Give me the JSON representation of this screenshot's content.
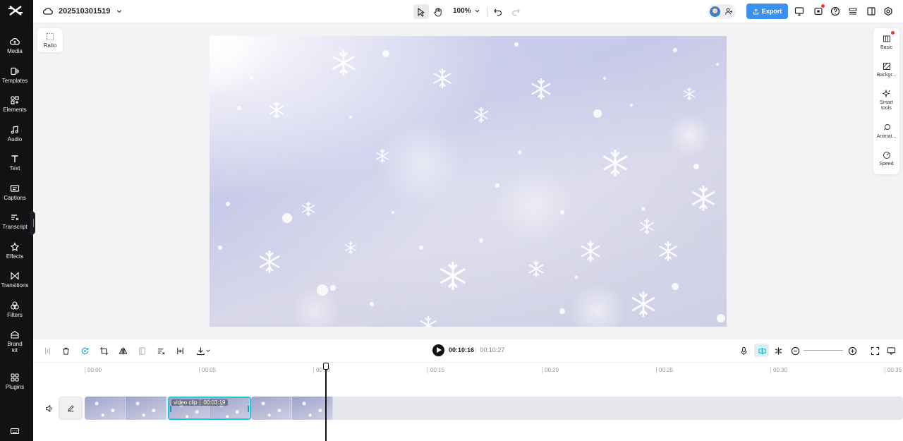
{
  "project": {
    "name": "202510301519"
  },
  "toolbar": {
    "zoom": "100%",
    "export_label": "Export"
  },
  "sidebar": {
    "items": [
      {
        "label": "Media",
        "icon": "cloud-upload-icon"
      },
      {
        "label": "Templates",
        "icon": "templates-icon"
      },
      {
        "label": "Elements",
        "icon": "elements-icon"
      },
      {
        "label": "Audio",
        "icon": "music-note-icon"
      },
      {
        "label": "Text",
        "icon": "text-icon"
      },
      {
        "label": "Captions",
        "icon": "captions-icon"
      },
      {
        "label": "Transcript",
        "icon": "transcript-icon"
      },
      {
        "label": "Effects",
        "icon": "effects-icon"
      },
      {
        "label": "Transitions",
        "icon": "transitions-icon"
      },
      {
        "label": "Filters",
        "icon": "filters-icon"
      },
      {
        "label": "Brand\nkit",
        "icon": "brand-kit-icon"
      },
      {
        "label": "Plugins",
        "icon": "plugins-icon"
      }
    ]
  },
  "canvas": {
    "ratio_label": "Ratio"
  },
  "right_panel": {
    "items": [
      {
        "label": "Basic",
        "icon": "basic-icon"
      },
      {
        "label": "Backgr...",
        "icon": "background-icon"
      },
      {
        "label": "Smart tools",
        "icon": "sparkle-icon"
      },
      {
        "label": "Animat...",
        "icon": "animation-icon"
      },
      {
        "label": "Speed",
        "icon": "speed-icon"
      }
    ]
  },
  "timeline": {
    "current_time": "00:10:16",
    "total_time": "00:10:27",
    "ruler": [
      "00:00",
      "00:05",
      "00:10",
      "00:15",
      "00:20",
      "00:25",
      "00:30",
      "00:35"
    ],
    "selected_clip": {
      "name": "video clip",
      "duration": "00:03:19"
    }
  }
}
